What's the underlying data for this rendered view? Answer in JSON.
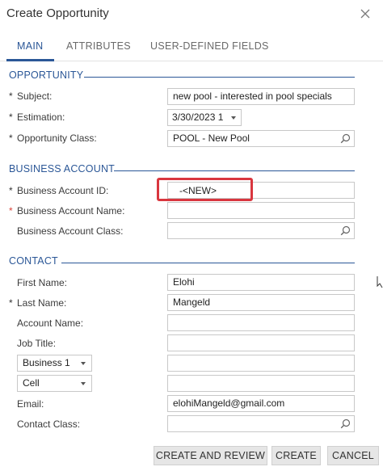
{
  "dialog": {
    "title": "Create Opportunity"
  },
  "tabs": [
    {
      "label": "MAIN",
      "active": true
    },
    {
      "label": "ATTRIBUTES",
      "active": false
    },
    {
      "label": "USER-DEFINED FIELDS",
      "active": false
    }
  ],
  "sections": {
    "opportunity": "OPPORTUNITY",
    "business_account": "BUSINESS ACCOUNT",
    "contact": "CONTACT"
  },
  "opportunity": {
    "subject_label": "Subject:",
    "subject_value": "new pool - interested in pool specials",
    "estimation_label": "Estimation:",
    "estimation_value": "3/30/2023 1",
    "class_label": "Opportunity Class:",
    "class_value": "POOL - New Pool"
  },
  "business_account": {
    "id_label": "Business Account ID:",
    "id_value": "-<NEW>",
    "name_label": "Business Account Name:",
    "name_value": "",
    "class_label": "Business Account Class:",
    "class_value": ""
  },
  "contact": {
    "first_name_label": "First Name:",
    "first_name_value": "Elohi",
    "last_name_label": "Last Name:",
    "last_name_value": "Mangeld",
    "account_name_label": "Account Name:",
    "account_name_value": "",
    "job_title_label": "Job Title:",
    "job_title_value": "",
    "phone1_type": "Business 1",
    "phone1_value": "",
    "phone2_type": "Cell",
    "phone2_value": "",
    "email_label": "Email:",
    "email_value": "elohiMangeld@gmail.com",
    "contact_class_label": "Contact Class:",
    "contact_class_value": ""
  },
  "required_marks": {
    "star": "*"
  },
  "footer": {
    "create_and_review": "CREATE AND REVIEW",
    "create": "CREATE",
    "cancel": "CANCEL"
  },
  "colors": {
    "accent": "#2b5797",
    "required_red": "#d9443a",
    "highlight": "#d9363e"
  },
  "icons": {
    "close": "close-icon",
    "search": "search-icon",
    "dropdown": "chevron-down-icon"
  }
}
